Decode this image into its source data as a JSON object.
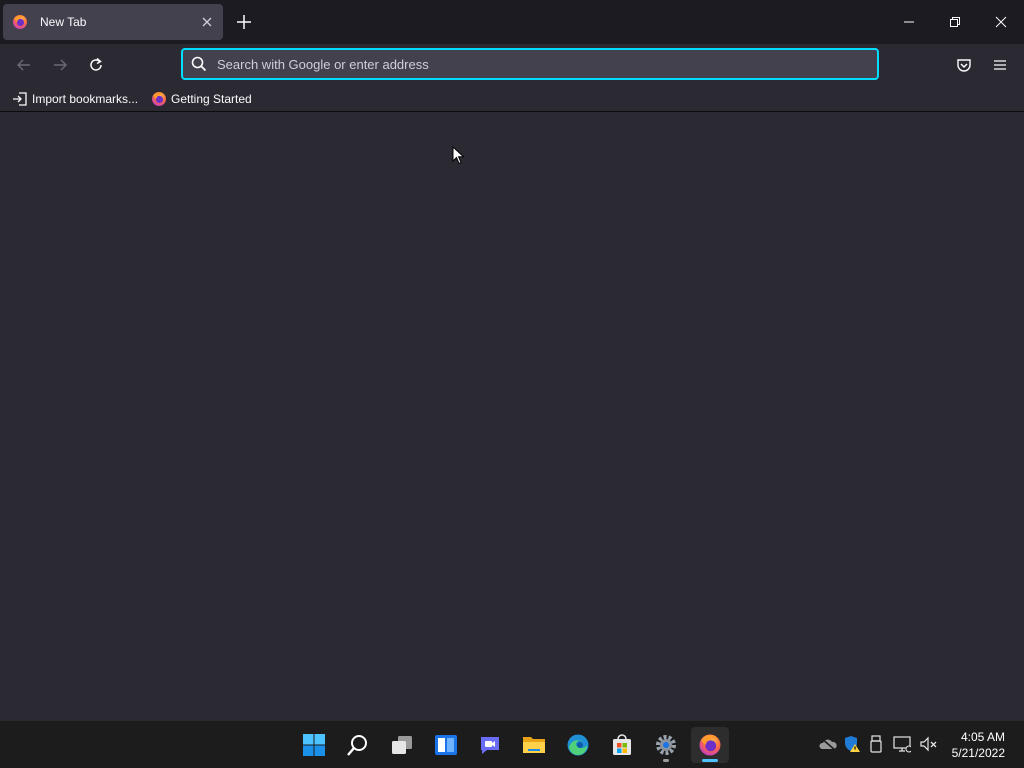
{
  "browser": {
    "tab": {
      "title": "New Tab",
      "favicon": "firefox-icon"
    },
    "urlbar": {
      "placeholder": "Search with Google or enter address",
      "value": ""
    },
    "bookmarks": [
      {
        "label": "Import bookmarks...",
        "icon": "import-icon"
      },
      {
        "label": "Getting Started",
        "icon": "firefox-icon"
      }
    ],
    "colors": {
      "accent": "#00ddff",
      "frame": "#1c1b22",
      "toolbar": "#2b2a33",
      "tab_selected": "#42414d"
    }
  },
  "taskbar": {
    "apps": [
      {
        "name": "start",
        "icon": "windows-start-icon"
      },
      {
        "name": "search",
        "icon": "search-icon"
      },
      {
        "name": "task-view",
        "icon": "task-view-icon"
      },
      {
        "name": "widgets",
        "icon": "widgets-icon"
      },
      {
        "name": "teams-chat",
        "icon": "teams-chat-icon"
      },
      {
        "name": "file-explorer",
        "icon": "folder-icon"
      },
      {
        "name": "edge",
        "icon": "edge-icon"
      },
      {
        "name": "store",
        "icon": "store-icon"
      },
      {
        "name": "settings",
        "icon": "gear-icon"
      },
      {
        "name": "firefox",
        "icon": "firefox-icon"
      }
    ],
    "tray": [
      "onedrive-offline-icon",
      "defender-warning-icon",
      "usb-icon",
      "network-icon",
      "volume-muted-icon"
    ],
    "clock": {
      "time": "4:05 AM",
      "date": "5/21/2022"
    }
  }
}
